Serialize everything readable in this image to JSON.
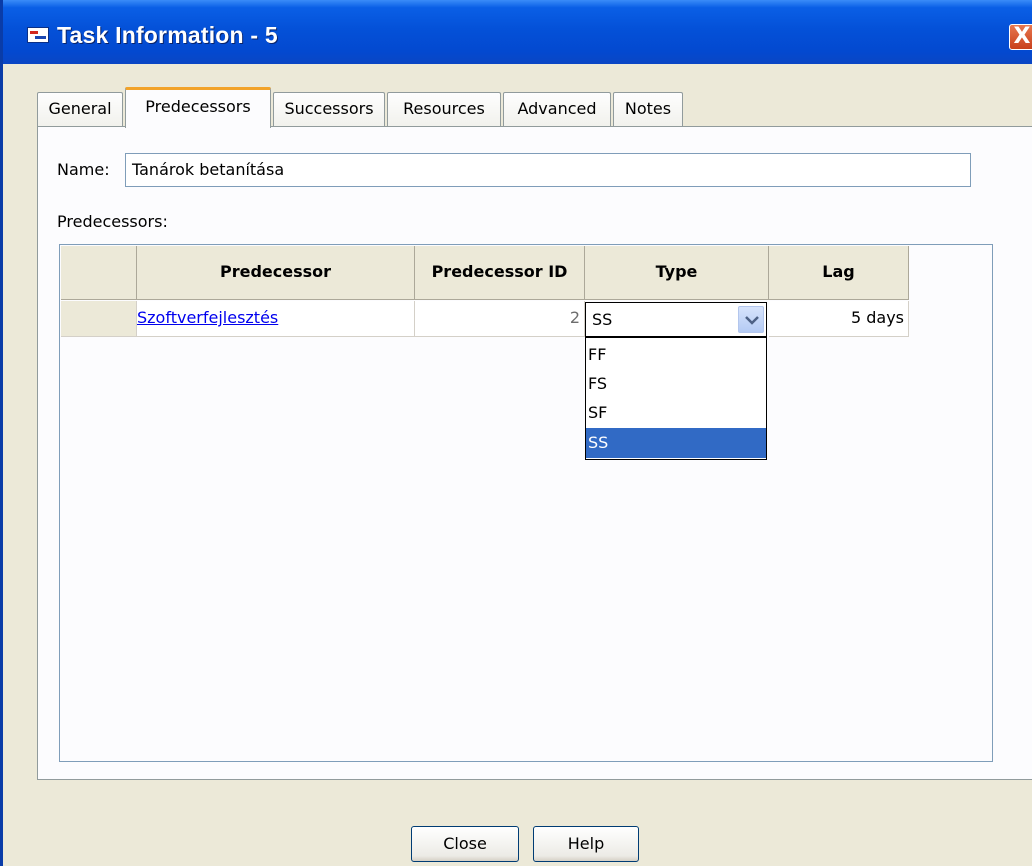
{
  "window": {
    "title": "Task Information - 5",
    "close_glyph": "X"
  },
  "tabs": [
    {
      "label": "General"
    },
    {
      "label": "Predecessors",
      "active": true
    },
    {
      "label": "Successors"
    },
    {
      "label": "Resources"
    },
    {
      "label": "Advanced"
    },
    {
      "label": "Notes"
    }
  ],
  "form": {
    "name_label": "Name:",
    "name_value": "Tanárok betanítása",
    "predecessors_label": "Predecessors:"
  },
  "grid": {
    "headers": [
      "",
      "Predecessor",
      "Predecessor ID",
      "Type",
      "Lag"
    ],
    "rows": [
      {
        "predecessor": "Szoftverfejlesztés",
        "predecessor_id": "2",
        "type": "SS",
        "lag": "5 days"
      }
    ]
  },
  "type_dropdown": {
    "options": [
      "FF",
      "FS",
      "SF",
      "SS"
    ],
    "selected": "SS"
  },
  "buttons": {
    "close": "Close",
    "help": "Help"
  },
  "colors": {
    "titlebar": "#0451d8",
    "selection": "#316ac5",
    "active_tab_accent": "#f2a32a",
    "link": "#0000ee"
  }
}
